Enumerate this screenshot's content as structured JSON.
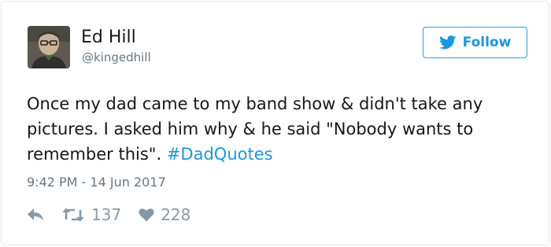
{
  "author": {
    "name": "Ed Hill",
    "handle": "@kingedhill"
  },
  "follow_button": {
    "label": "Follow",
    "icon": "twitter-bird-icon"
  },
  "tweet": {
    "text": "Once my dad came to my band show & didn't take any pictures. I asked him why & he said \"Nobody wants to remember this\".",
    "hashtag": "#DadQuotes",
    "timestamp": "9:42 PM - 14 Jun 2017"
  },
  "actions": {
    "reply_icon": "reply-icon",
    "retweet_icon": "retweet-icon",
    "retweet_count": "137",
    "like_icon": "heart-icon",
    "like_count": "228"
  },
  "colors": {
    "accent": "#1b95e0",
    "muted": "#657786",
    "icon_muted": "#8899a6",
    "text": "#14171a",
    "border": "#e1e8ed"
  }
}
